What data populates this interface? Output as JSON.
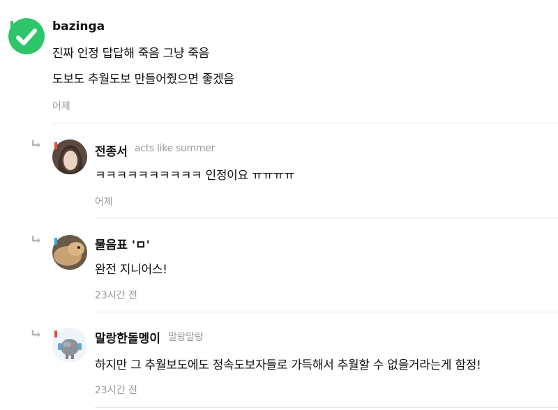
{
  "top_comment": {
    "author": "bazinga",
    "lines": [
      "진짜 인정 답답해 죽음 그냥 죽음",
      "도보도 추월도보 만들어줬으면 좋겠음"
    ],
    "time": "어제",
    "avatar_color": "#2dc46a",
    "badge_color": "#2dc46a"
  },
  "replies": [
    {
      "author": "전종서",
      "subname": "acts like summer",
      "text": "ㅋㅋㅋㅋㅋㅋㅋㅋㅋㅋ 인정이요 ㅠㅠㅠㅠ",
      "time": "어제",
      "badge_color": "#e94b3c"
    },
    {
      "author": "물음표 'ㅁ'",
      "subname": "",
      "text": "완전 지니어스!",
      "time": "23시간 전",
      "badge_color": "#3aa0e8"
    },
    {
      "author": "말랑한돌멩이",
      "subname": "말랑말랑",
      "text": "하지만 그 추월보도에도 정속도보자들로 가득해서 추월할 수 없을거라는게 함정!",
      "time": "23시간 전",
      "badge_color": "#e94b3c"
    }
  ]
}
